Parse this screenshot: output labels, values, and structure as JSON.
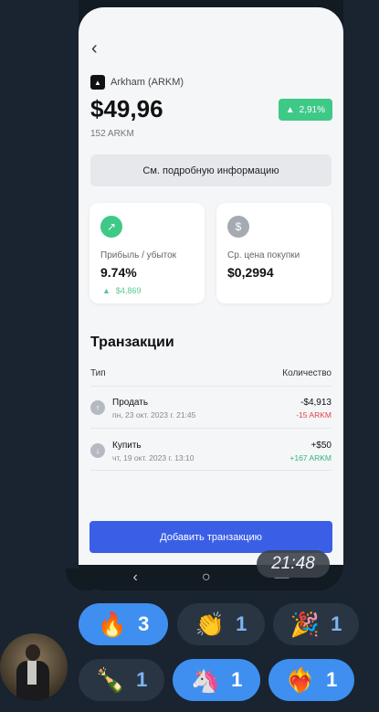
{
  "app": {
    "coin_label": "Arkham (ARKM)",
    "price": "$49,96",
    "holding": "152 ARKM",
    "change_badge": "2,91%",
    "info_button": "См. подробную информацию",
    "cards": [
      {
        "icon": "trend-up-icon",
        "color": "#3ec986",
        "label": "Прибыль / убыток",
        "value": "9.74%",
        "sub": "$4,869"
      },
      {
        "icon": "dollar-icon",
        "color": "#a5aab3",
        "label": "Ср. цена покупки",
        "value": "$0,2994"
      }
    ],
    "transactions_title": "Транзакции",
    "col_type": "Тип",
    "col_qty": "Количество",
    "transactions": [
      {
        "type": "Продать",
        "date": "пн, 23 окт. 2023 г. 21:45",
        "amount": "-$4,913",
        "qty": "-15 ARKM",
        "qty_color": "#e0414b",
        "arrow": "↑"
      },
      {
        "type": "Купить",
        "date": "чт, 19 окт. 2023 г. 13:10",
        "amount": "+$50",
        "qty": "+167 ARKM",
        "qty_color": "#2fb77a",
        "arrow": "↓"
      }
    ],
    "add_button": "Добавить транзакцию"
  },
  "message": {
    "time": "21:48"
  },
  "reactions": [
    {
      "emoji": "🔥",
      "count": "3",
      "mine": true
    },
    {
      "emoji": "👏",
      "count": "1",
      "mine": false
    },
    {
      "emoji": "🎉",
      "count": "1",
      "mine": false
    },
    {
      "emoji": "🍾",
      "count": "1",
      "mine": false
    },
    {
      "emoji": "🦄",
      "count": "1",
      "mine": true
    },
    {
      "emoji": "❤️‍🔥",
      "count": "1",
      "mine": true
    }
  ],
  "colors": {
    "accent": "#3a5fe6",
    "positive": "#3ec986",
    "negative": "#e0414b",
    "chat_bg": "#1a2330",
    "reaction_mine": "#3e8ff0"
  }
}
